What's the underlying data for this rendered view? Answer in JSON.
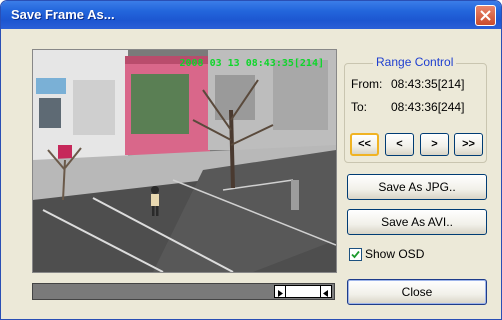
{
  "window": {
    "title": "Save Frame As..."
  },
  "video": {
    "osd_text": "2008 03 13 08:43:35[214]"
  },
  "range_control": {
    "label": "Range Control",
    "from_label": "From:",
    "from_value": "08:43:35[214]",
    "to_label": "To:",
    "to_value": "08:43:36[244]"
  },
  "nav": {
    "first": "<<",
    "prev": "<",
    "next": ">",
    "last": ">>"
  },
  "buttons": {
    "save_jpg": "Save As JPG..",
    "save_avi": "Save As AVI..",
    "close": "Close"
  },
  "show_osd": {
    "label": "Show OSD",
    "checked": true
  },
  "timeline": {
    "position_fraction": 0.82
  },
  "colors": {
    "osd_green": "#0ed62a",
    "group_label_blue": "#1f3fd0",
    "title_bar_blue": "#1c56d1"
  }
}
